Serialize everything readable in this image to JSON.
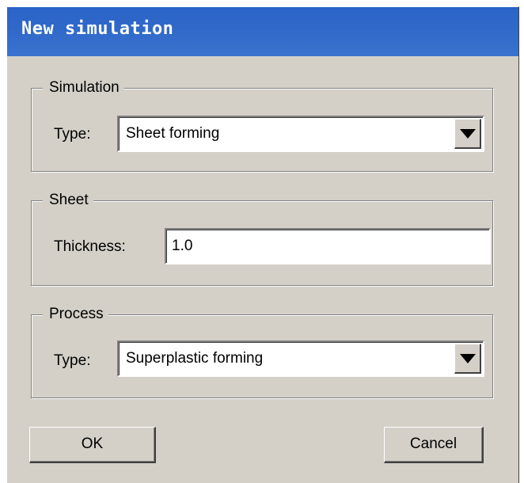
{
  "dialog": {
    "title": "New simulation"
  },
  "simulation_group": {
    "legend": "Simulation",
    "type_label": "Type:",
    "type_value": "Sheet forming"
  },
  "sheet_group": {
    "legend": "Sheet",
    "thickness_label": "Thickness:",
    "thickness_value": "1.0"
  },
  "process_group": {
    "legend": "Process",
    "type_label": "Type:",
    "type_value": "Superplastic forming"
  },
  "buttons": {
    "ok_label": "OK",
    "cancel_label": "Cancel"
  },
  "icons": {
    "combo_arrow": "chevron-down-icon"
  },
  "colors": {
    "titlebar": "#2f68c8",
    "dialog_bg": "#d4d0c8",
    "title_text": "#ffffff"
  }
}
